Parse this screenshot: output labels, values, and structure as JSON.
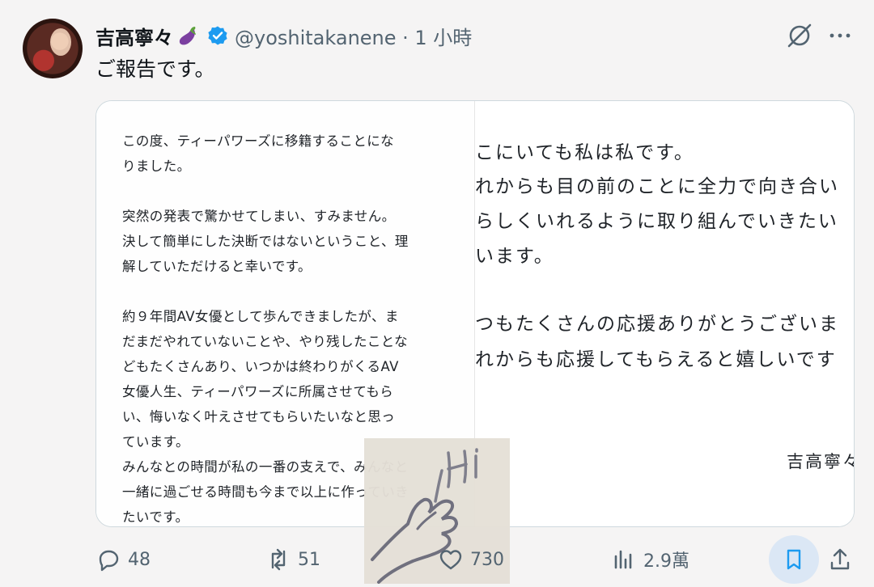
{
  "tweet": {
    "name": "吉高寧々",
    "handle_time": "@yoshitakanene · 1 小時",
    "text": "ご報告です。"
  },
  "image": {
    "left_lines": [
      "この度、ティーパワーズに移籍することにな",
      "りました。",
      "",
      "突然の発表で驚かせてしまい、すみません。",
      "決して簡単にした決断ではないということ、理",
      "解していただけると幸いです。",
      "",
      "約９年間AV女優として歩んできましたが、ま",
      "だまだやれていないことや、やり残したことな",
      "どもたくさんあり、いつかは終わりがくるAV",
      "女優人生、ティーパワーズに所属させてもら",
      "い、悔いなく叶えさせてもらいたいなと思っ",
      "ています。",
      "みんなとの時間が私の一番の支えで、みんなと",
      "一緒に過ごせる時間も今まで以上に作っていき",
      "たいです。"
    ],
    "right_lines": [
      "こにいても私は私です。",
      "れからも目の前のことに全力で向き合い",
      "らしくいれるように取り組んでいきたい",
      "います。",
      "つもたくさんの応援ありがとうございま",
      "れからも応援してもらえると嬉しいです"
    ],
    "signature": "吉高寧々"
  },
  "actions": {
    "replies": "48",
    "reposts": "51",
    "likes": "730",
    "views": "2.9萬"
  },
  "colors": {
    "background": "#f5f4f4",
    "muted": "#536471",
    "verified": "#1d9bf0",
    "bookmark_bg": "#dbe7f5",
    "bookmark_icon": "#1d9bf0"
  }
}
